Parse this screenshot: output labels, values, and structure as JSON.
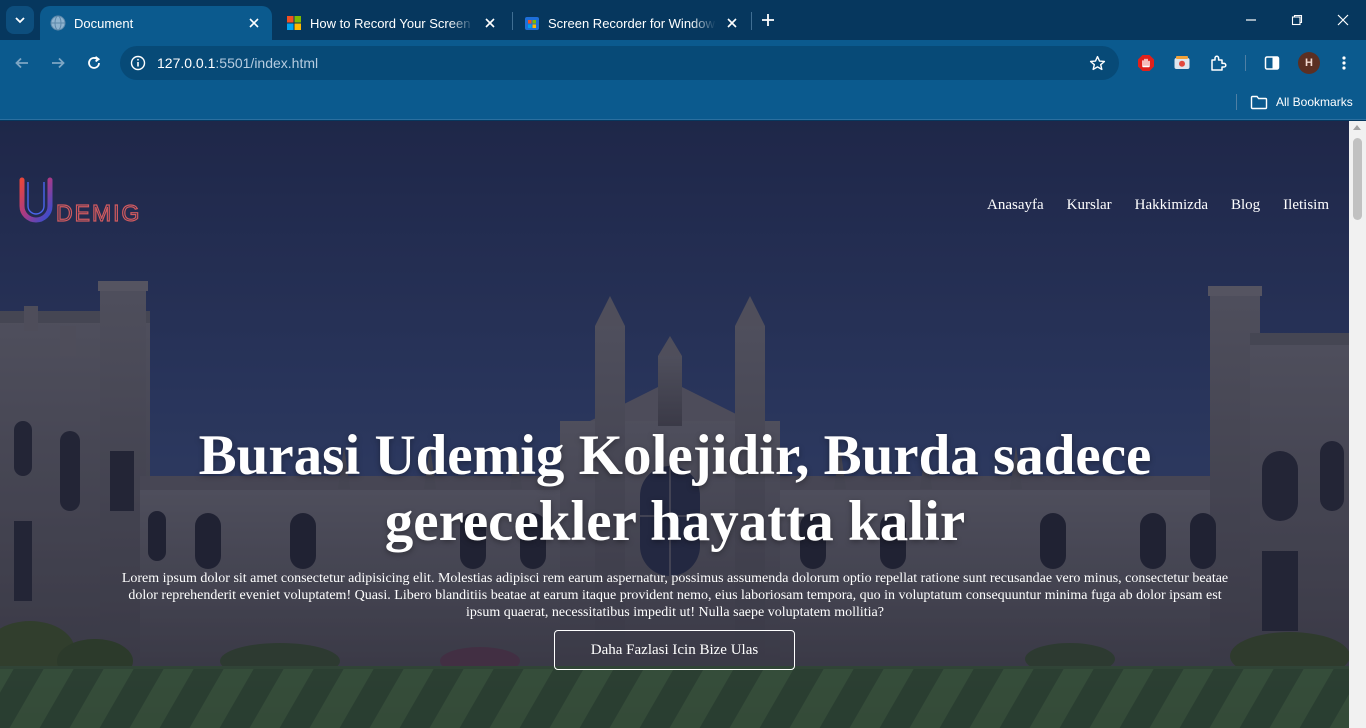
{
  "browser": {
    "tabs": [
      {
        "title": "Document",
        "active": true,
        "favicon": "globe-icon"
      },
      {
        "title": "How to Record Your Screen on Windows",
        "active": false,
        "favicon": "microsoft-logo-icon"
      },
      {
        "title": "Screen Recorder for Windows 10",
        "active": false,
        "favicon": "app-store-icon"
      }
    ],
    "url_host": "127.0.0.1",
    "url_rest": ":5501/index.html",
    "profile_initial": "H",
    "bookmarks_label": "All Bookmarks",
    "colors": {
      "frame": "#06375e",
      "toolbar": "#0b5a8e",
      "omnibox": "#074a77"
    }
  },
  "site": {
    "logo_text": "DEMIG",
    "nav": [
      "Anasayfa",
      "Kurslar",
      "Hakkimizda",
      "Blog",
      "Iletisim"
    ],
    "hero": {
      "title": "Burasi Udemig Kolejidir, Burda sadece gerecekler hayatta kalir",
      "text": "Lorem ipsum dolor sit amet consectetur adipisicing elit. Molestias adipisci rem earum aspernatur, possimus assumenda dolorum optio repellat ratione sunt recusandae vero minus, consectetur beatae dolor reprehenderit eveniet voluptatem! Quasi. Libero blanditiis beatae at earum itaque provident nemo, eius laboriosam tempora, quo in voluptatum consequuntur minima fuga ab dolor ipsam est ipsum quaerat, necessitatibus impedit ut! Nulla saepe voluptatem mollitia?",
      "button": "Daha Fazlasi Icin Bize Ulas"
    }
  }
}
